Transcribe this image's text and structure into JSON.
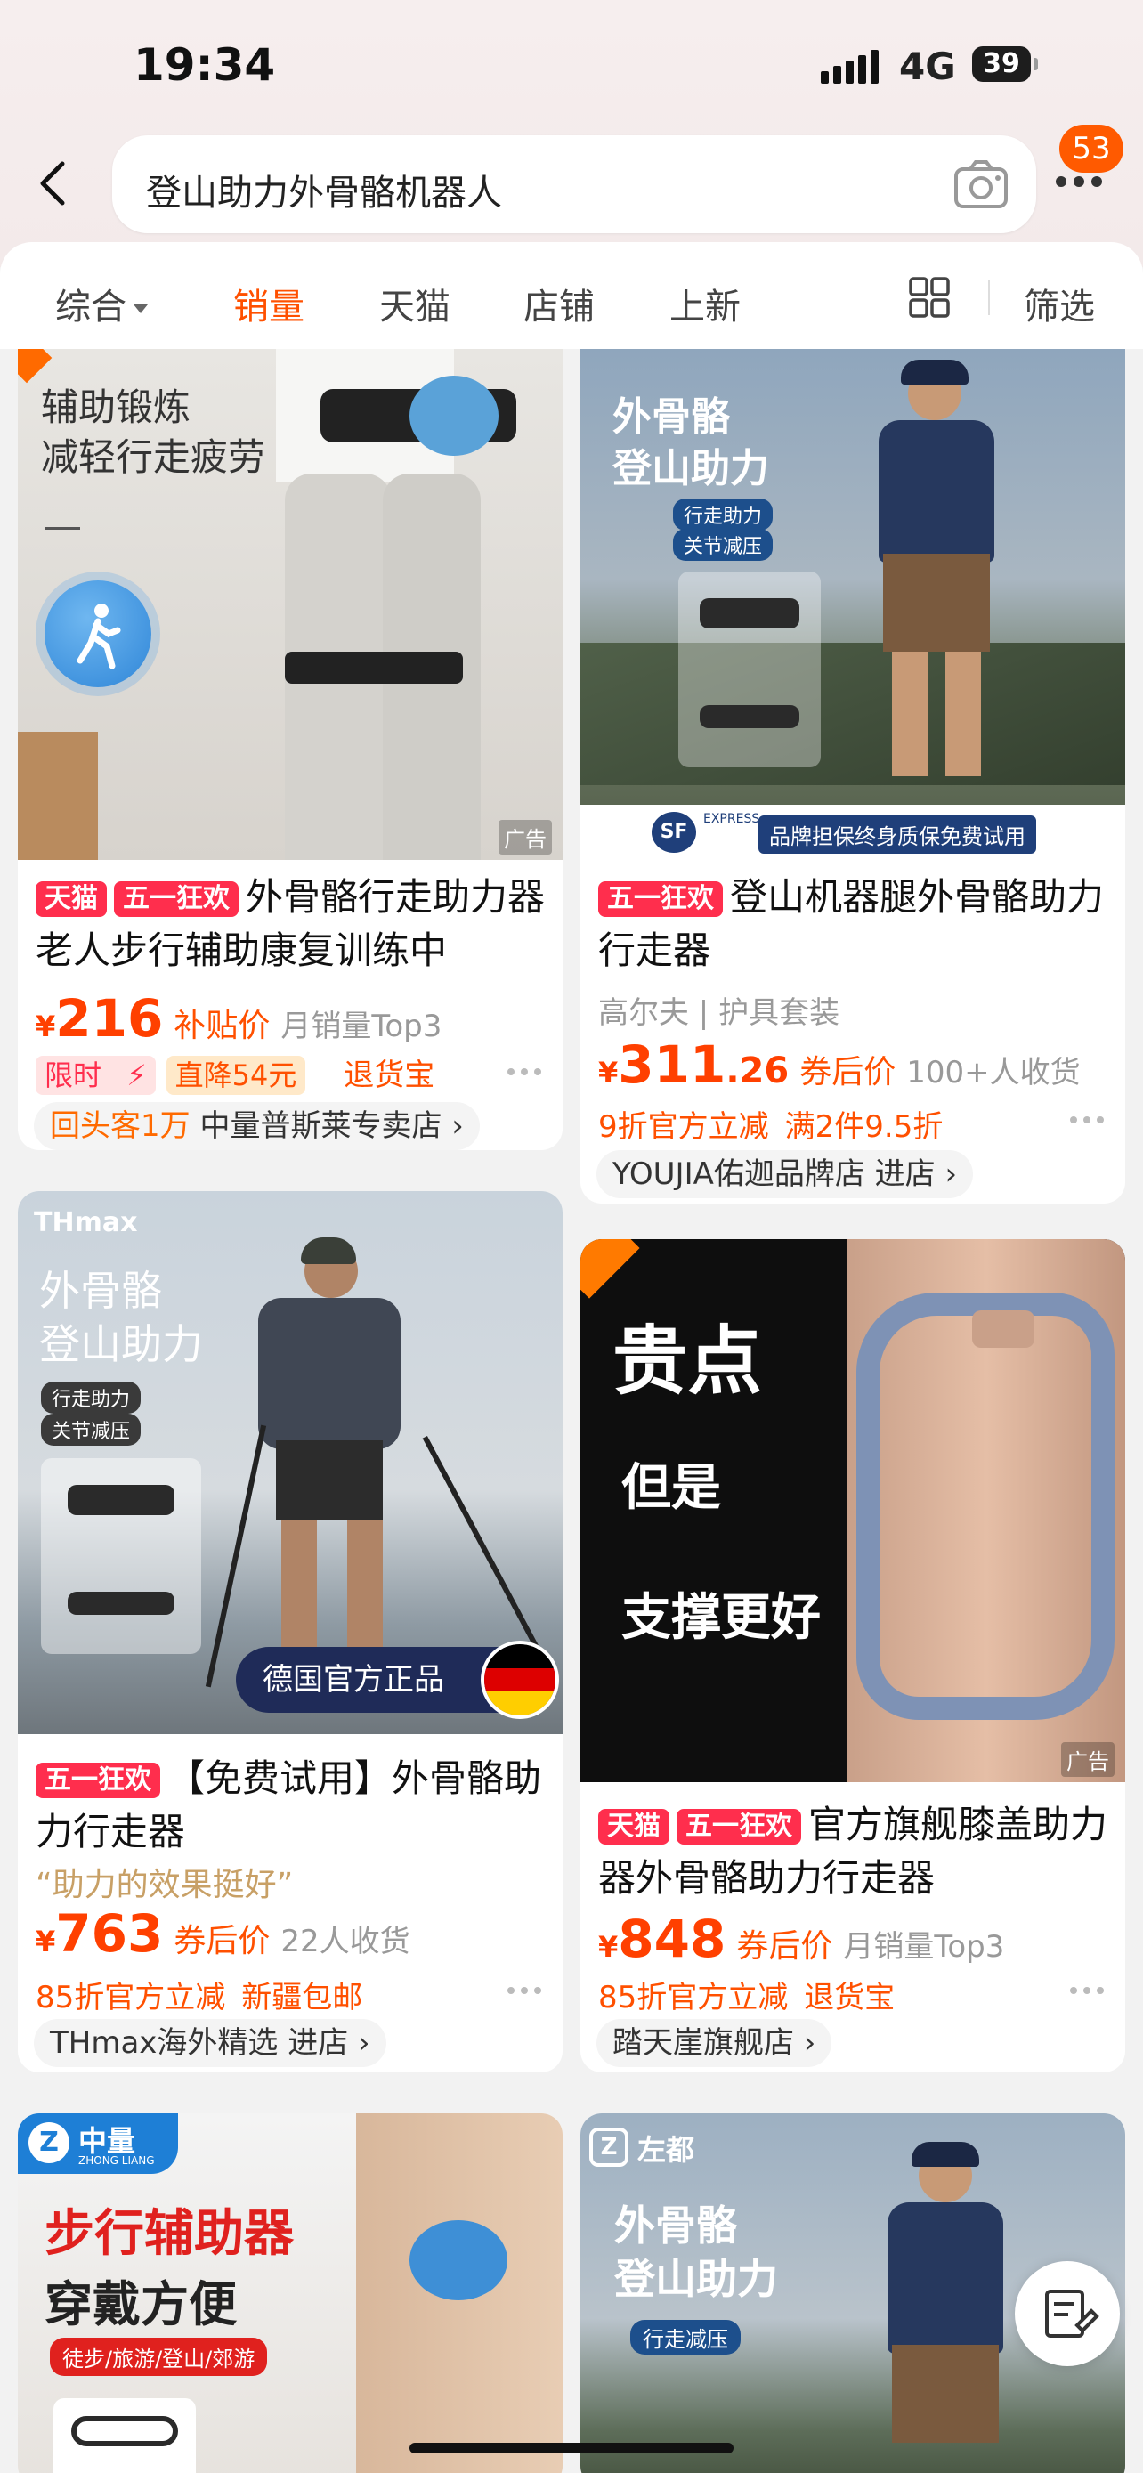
{
  "status": {
    "time": "19:34",
    "network": "4G",
    "battery": "39"
  },
  "search": {
    "query": "登山助力外骨骼机器人"
  },
  "message_badge": "53",
  "tabs": [
    {
      "label": "综合"
    },
    {
      "label": "销量"
    },
    {
      "label": "天猫"
    },
    {
      "label": "店铺"
    },
    {
      "label": "上新"
    }
  ],
  "filter_label": "筛选",
  "ad_label": "广告",
  "products": [
    {
      "image_text": [
        "辅助锻炼",
        "减轻行走疲劳"
      ],
      "tags": [
        "天猫",
        "五一狂欢"
      ],
      "title": "外骨骼行走助力器老人步行辅助康复训练中",
      "currency": "¥",
      "price": "216",
      "price_label": "补贴价",
      "sales": "月销量Top3",
      "limit": "限时",
      "drop": "直降54元",
      "promos": [
        "退货宝"
      ],
      "shop_prefix": "回头客1万",
      "shop": "中量普斯莱专卖店 ›"
    },
    {
      "image_text": [
        "外骨骼",
        "登山助力",
        "行走助力",
        "关节减压",
        "品牌担保终身质保免费试用",
        "EXPRESS"
      ],
      "tags": [
        "五一狂欢"
      ],
      "title": "登山机器腿外骨骼助力行走器",
      "subtitle": "高尔夫 | 护具套装",
      "currency": "¥",
      "price": "311",
      "price_dec": ".26",
      "price_label": "券后价",
      "sales": "100+人收货",
      "promos": [
        "9折官方立减",
        "满2件9.5折"
      ],
      "shop": "YOUJIA佑迦品牌店 进店 ›"
    },
    {
      "image_text": [
        "THmax",
        "外骨骼",
        "登山助力",
        "行走助力",
        "关节减压",
        "德国官方正品"
      ],
      "tags": [
        "五一狂欢"
      ],
      "title": "【免费试用】外骨骼助力行走器",
      "quote": "“助力的效果挺好”",
      "currency": "¥",
      "price": "763",
      "price_label": "券后价",
      "sales": "22人收货",
      "promos": [
        "85折官方立减",
        "新疆包邮"
      ],
      "shop": "THmax海外精选 进店 ›"
    },
    {
      "image_text": [
        "贵点",
        "但是",
        "支撑更好"
      ],
      "tags": [
        "天猫",
        "五一狂欢"
      ],
      "title": "官方旗舰膝盖助力器外骨骼助力行走器",
      "currency": "¥",
      "price": "848",
      "price_label": "券后价",
      "sales": "月销量Top3",
      "promos": [
        "85折官方立减",
        "退货宝"
      ],
      "shop": "踏天崖旗舰店 ›"
    },
    {
      "image_text": [
        "中量",
        "ZHONG LIANG",
        "步行辅助器",
        "穿戴方便",
        "徒步/旅游/登山/郊游"
      ]
    },
    {
      "image_text": [
        "左都",
        "外骨骼",
        "登山助力",
        "行走减压"
      ]
    }
  ],
  "colors": {
    "accent": "#ff5000",
    "tag_red": "#ff2e4d",
    "background": "#f2f2f2"
  }
}
